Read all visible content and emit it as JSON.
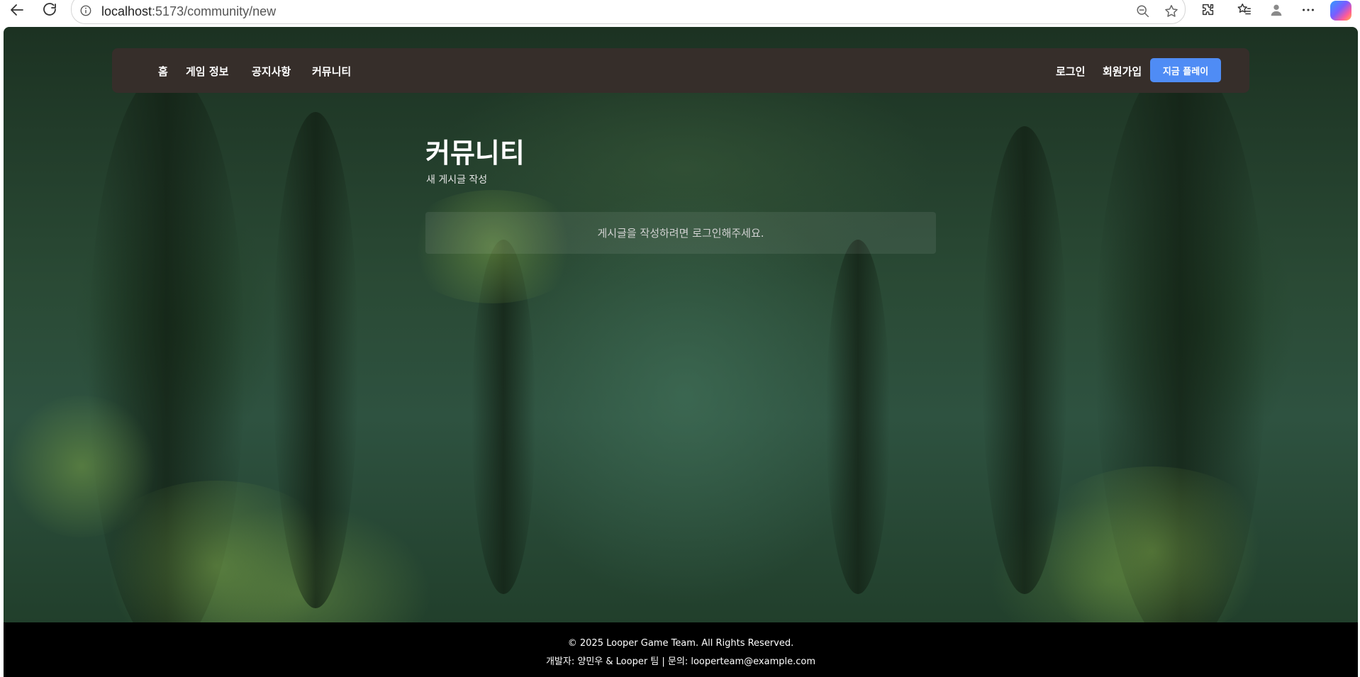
{
  "browser": {
    "url_host": "localhost",
    "url_rest": ":5173/community/new"
  },
  "nav": {
    "items": [
      {
        "label": "홈"
      },
      {
        "label": "게임 정보"
      },
      {
        "label": "공지사항"
      },
      {
        "label": "커뮤니티"
      }
    ],
    "login_label": "로그인",
    "signup_label": "회원가입",
    "play_label": "지금 플레이"
  },
  "main": {
    "title": "커뮤니티",
    "subtitle": "새 게시글 작성",
    "notice": "게시글을 작성하려면 로그인해주세요."
  },
  "footer": {
    "copyright": "© 2025 Looper Game Team. All Rights Reserved.",
    "credits": "개발자: 양민우 & Looper 팀 | 문의: looperteam@example.com"
  },
  "colors": {
    "header_bg": "#362e2a",
    "accent": "#4f8cf5",
    "footer_bg": "#000000"
  },
  "icons": {
    "back": "back-arrow-icon",
    "reload": "reload-icon",
    "site_info": "info-icon",
    "zoom": "zoom-out-icon",
    "favorite": "star-icon",
    "extensions": "puzzle-icon",
    "favorites_list": "favorites-list-icon",
    "profile": "profile-icon",
    "more": "more-icon",
    "copilot": "copilot-icon"
  }
}
